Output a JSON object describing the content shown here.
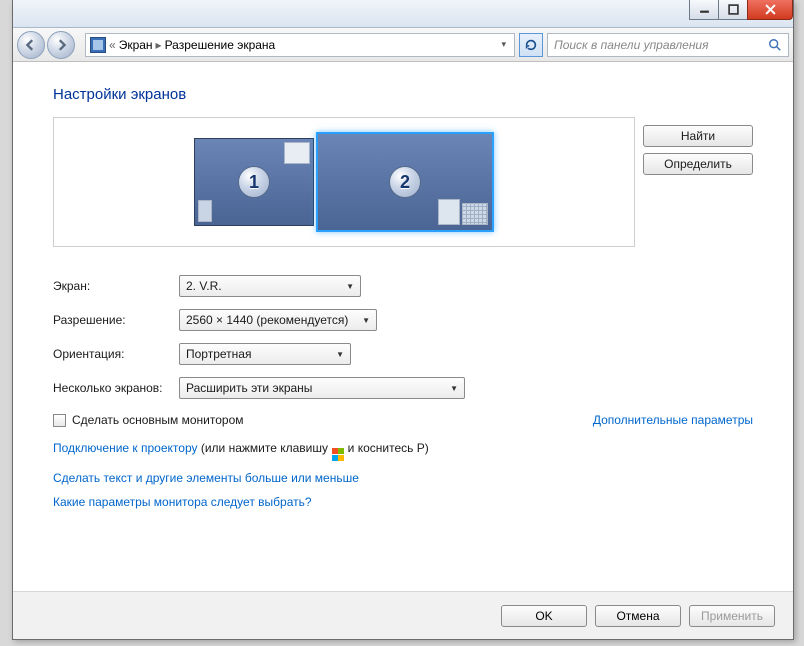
{
  "breadcrumb": {
    "item1": "Экран",
    "item2": "Разрешение экрана"
  },
  "search": {
    "placeholder": "Поиск в панели управления"
  },
  "page_title": "Настройки экранов",
  "monitors": {
    "m1": "1",
    "m2": "2"
  },
  "side_buttons": {
    "find": "Найти",
    "identify": "Определить"
  },
  "form": {
    "display_label": "Экран:",
    "display_value": "2. V.R.",
    "resolution_label": "Разрешение:",
    "resolution_value": "2560 × 1440 (рекомендуется)",
    "orientation_label": "Ориентация:",
    "orientation_value": "Портретная",
    "multi_label": "Несколько экранов:",
    "multi_value": "Расширить эти экраны"
  },
  "checkbox_label": "Сделать основным монитором",
  "advanced_link": "Дополнительные параметры",
  "links": {
    "projector_link": "Подключение к проектору",
    "projector_tail_a": " (или нажмите клавишу ",
    "projector_tail_b": " и коснитесь P)",
    "text_size": "Сделать текст и другие элементы больше или меньше",
    "which_settings": "Какие параметры монитора следует выбрать?"
  },
  "footer": {
    "ok": "OK",
    "cancel": "Отмена",
    "apply": "Применить"
  }
}
